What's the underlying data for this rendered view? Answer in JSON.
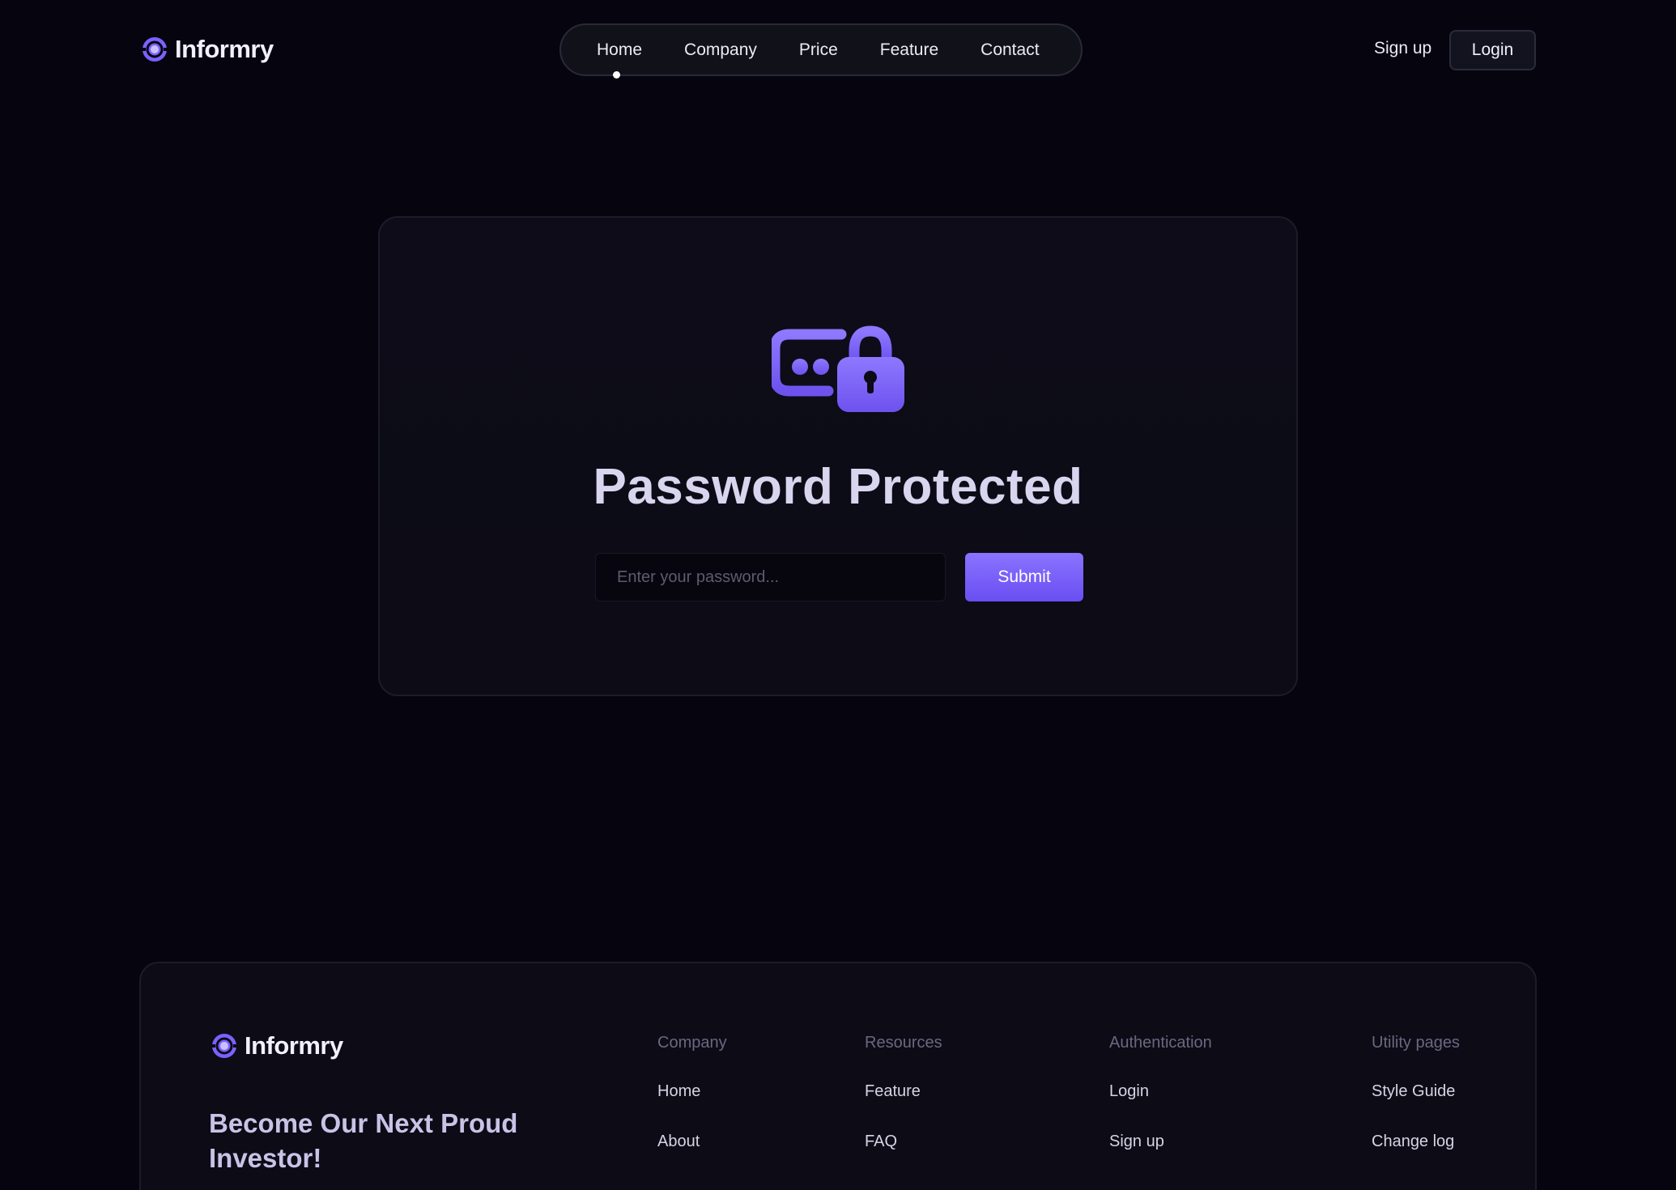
{
  "brand": {
    "name": "Informry",
    "accent": "#7b61ff"
  },
  "nav": {
    "items": [
      {
        "label": "Home",
        "active": true
      },
      {
        "label": "Company"
      },
      {
        "label": "Price"
      },
      {
        "label": "Feature"
      },
      {
        "label": "Contact"
      }
    ]
  },
  "header": {
    "signup_label": "Sign up",
    "login_label": "Login"
  },
  "protect": {
    "icon": "password-lock-icon",
    "title": "Password Protected",
    "input_placeholder": "Enter your password...",
    "input_value": "",
    "submit_label": "Submit"
  },
  "footer": {
    "tagline": "Become Our Next Proud Investor!",
    "columns": [
      {
        "heading": "Company",
        "links": [
          "Home",
          "About"
        ]
      },
      {
        "heading": "Resources",
        "links": [
          "Feature",
          "FAQ"
        ]
      },
      {
        "heading": "Authentication",
        "links": [
          "Login",
          "Sign up"
        ]
      },
      {
        "heading": "Utility pages",
        "links": [
          "Style Guide",
          "Change log"
        ]
      }
    ]
  }
}
